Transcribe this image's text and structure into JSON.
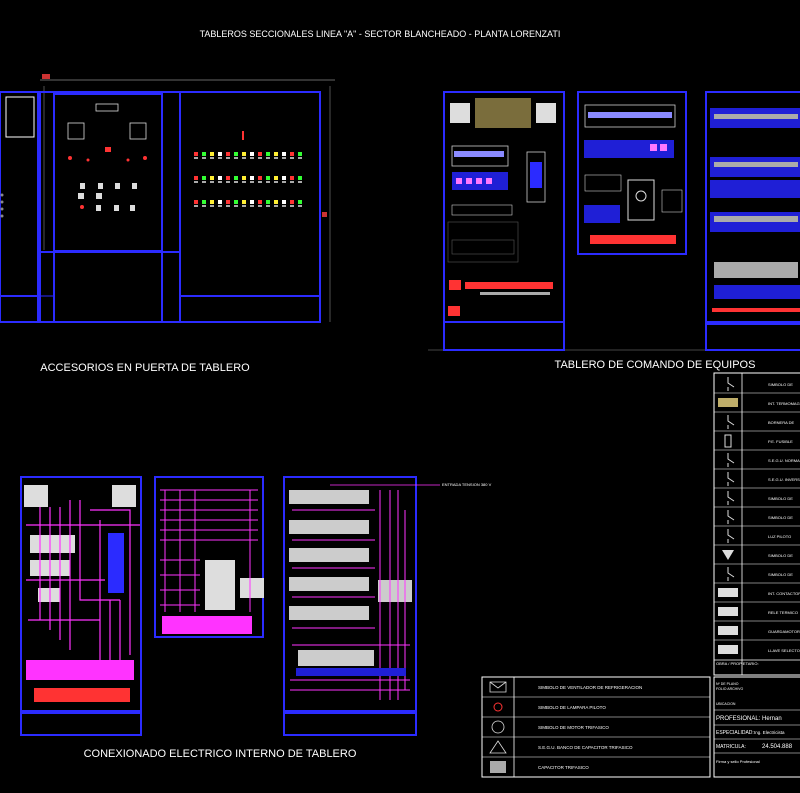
{
  "sheet": {
    "title": "TABLEROS SECCIONALES LINEA \"A\"  -  SECTOR BLANCHEADO - PLANTA LORENZATI"
  },
  "sections": {
    "door_accessories": "ACCESORIOS EN PUERTA DE TABLERO",
    "command_board": "TABLERO DE COMANDO DE EQUIPOS",
    "internal_wiring": "CONEXIONADO ELECTRICO INTERNO DE TABLERO"
  },
  "wire_tag": "ENTRADA TENSION 380 V",
  "legend_right": [
    {
      "icon": "switch-symbol",
      "label": "SIMBOLO DE"
    },
    {
      "icon": "bornera-block",
      "label": "INT. TERMOMAGNETICO"
    },
    {
      "icon": "bornera-red",
      "label": "BORNERA DE"
    },
    {
      "icon": "fuse",
      "label": "P.E. FUSIBLE"
    },
    {
      "icon": "contact-symbol",
      "label": "S.E.G.U. NORMAL"
    },
    {
      "icon": "contact-symbol",
      "label": "S.E.G.U. INVERSOR"
    },
    {
      "icon": "contact-symbol",
      "label": "SIMBOLO DE"
    },
    {
      "icon": "contact-symbol",
      "label": "SIMBOLO DE"
    },
    {
      "icon": "contact-symbol",
      "label": "LUZ PILOTO"
    },
    {
      "icon": "triangle-symbol",
      "label": "SIMBOLO DE"
    },
    {
      "icon": "coil-symbol",
      "label": "SIMBOLO DE"
    },
    {
      "icon": "contactor-block",
      "label": "INT. CONTACTOR"
    },
    {
      "icon": "relay-block",
      "label": "RELE TERMICO"
    },
    {
      "icon": "relay-block",
      "label": "GUARDAMOTOR"
    },
    {
      "icon": "relay-block",
      "label": "LLAVE SELECTORA"
    }
  ],
  "legend_bottom": [
    {
      "icon": "envelope-symbol",
      "label": "SIMBOLO DE VENTILADOR DE REFRIGERACION"
    },
    {
      "icon": "lamp-symbol",
      "label": "SIMBOLO DE LAMPARA PILOTO"
    },
    {
      "icon": "motor-symbol",
      "label": "SIMBOLO DE MOTOR TRIFASICO"
    },
    {
      "icon": "capacitor-symbol",
      "label": "S.E.G.U. BANCO DE CAPACITOR TRIFASICO"
    },
    {
      "icon": "capacitor-bank",
      "label": "CAPACITOR TRIFASICO"
    }
  ],
  "title_block": {
    "work_label": "OBRA / PROPIETARIO:",
    "plan_label": "Nº DE PLANO",
    "file_label": "FOLIO ARCHIVO",
    "location_label": "UBICACION",
    "professional_label": "PROFESIONAL:",
    "professional_value": "Hernan",
    "specialty_label": "ESPECIALIDAD:",
    "specialty_value": "Ing. Electricista",
    "registration_label": "MATRICULA:",
    "registration_value": "24.504.888",
    "signature_label": "Firma y sello Profesional"
  }
}
